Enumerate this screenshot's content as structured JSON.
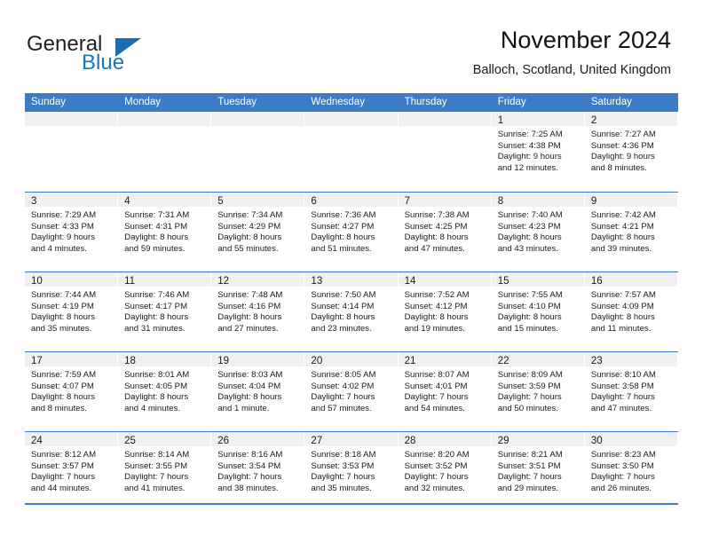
{
  "brand": {
    "name_part1": "General",
    "name_part2": "Blue",
    "triangle_color": "#1b6cb0",
    "blue_text_color": "#1b76bc"
  },
  "header": {
    "title": "November 2024",
    "subtitle": "Balloch, Scotland, United Kingdom"
  },
  "theme": {
    "header_row_color": "#3b7cc4",
    "day_band_color": "#f0f0f0",
    "grid_line_color": "#3b7cc4"
  },
  "weekdays": [
    "Sunday",
    "Monday",
    "Tuesday",
    "Wednesday",
    "Thursday",
    "Friday",
    "Saturday"
  ],
  "weeks": [
    [
      {
        "day": "",
        "empty": true,
        "sunrise": "",
        "sunset": "",
        "daylight_line1": "",
        "daylight_line2": ""
      },
      {
        "day": "",
        "empty": true,
        "sunrise": "",
        "sunset": "",
        "daylight_line1": "",
        "daylight_line2": ""
      },
      {
        "day": "",
        "empty": true,
        "sunrise": "",
        "sunset": "",
        "daylight_line1": "",
        "daylight_line2": ""
      },
      {
        "day": "",
        "empty": true,
        "sunrise": "",
        "sunset": "",
        "daylight_line1": "",
        "daylight_line2": ""
      },
      {
        "day": "",
        "empty": true,
        "sunrise": "",
        "sunset": "",
        "daylight_line1": "",
        "daylight_line2": ""
      },
      {
        "day": "1",
        "empty": false,
        "sunrise": "Sunrise: 7:25 AM",
        "sunset": "Sunset: 4:38 PM",
        "daylight_line1": "Daylight: 9 hours",
        "daylight_line2": "and 12 minutes."
      },
      {
        "day": "2",
        "empty": false,
        "sunrise": "Sunrise: 7:27 AM",
        "sunset": "Sunset: 4:36 PM",
        "daylight_line1": "Daylight: 9 hours",
        "daylight_line2": "and 8 minutes."
      }
    ],
    [
      {
        "day": "3",
        "empty": false,
        "sunrise": "Sunrise: 7:29 AM",
        "sunset": "Sunset: 4:33 PM",
        "daylight_line1": "Daylight: 9 hours",
        "daylight_line2": "and 4 minutes."
      },
      {
        "day": "4",
        "empty": false,
        "sunrise": "Sunrise: 7:31 AM",
        "sunset": "Sunset: 4:31 PM",
        "daylight_line1": "Daylight: 8 hours",
        "daylight_line2": "and 59 minutes."
      },
      {
        "day": "5",
        "empty": false,
        "sunrise": "Sunrise: 7:34 AM",
        "sunset": "Sunset: 4:29 PM",
        "daylight_line1": "Daylight: 8 hours",
        "daylight_line2": "and 55 minutes."
      },
      {
        "day": "6",
        "empty": false,
        "sunrise": "Sunrise: 7:36 AM",
        "sunset": "Sunset: 4:27 PM",
        "daylight_line1": "Daylight: 8 hours",
        "daylight_line2": "and 51 minutes."
      },
      {
        "day": "7",
        "empty": false,
        "sunrise": "Sunrise: 7:38 AM",
        "sunset": "Sunset: 4:25 PM",
        "daylight_line1": "Daylight: 8 hours",
        "daylight_line2": "and 47 minutes."
      },
      {
        "day": "8",
        "empty": false,
        "sunrise": "Sunrise: 7:40 AM",
        "sunset": "Sunset: 4:23 PM",
        "daylight_line1": "Daylight: 8 hours",
        "daylight_line2": "and 43 minutes."
      },
      {
        "day": "9",
        "empty": false,
        "sunrise": "Sunrise: 7:42 AM",
        "sunset": "Sunset: 4:21 PM",
        "daylight_line1": "Daylight: 8 hours",
        "daylight_line2": "and 39 minutes."
      }
    ],
    [
      {
        "day": "10",
        "empty": false,
        "sunrise": "Sunrise: 7:44 AM",
        "sunset": "Sunset: 4:19 PM",
        "daylight_line1": "Daylight: 8 hours",
        "daylight_line2": "and 35 minutes."
      },
      {
        "day": "11",
        "empty": false,
        "sunrise": "Sunrise: 7:46 AM",
        "sunset": "Sunset: 4:17 PM",
        "daylight_line1": "Daylight: 8 hours",
        "daylight_line2": "and 31 minutes."
      },
      {
        "day": "12",
        "empty": false,
        "sunrise": "Sunrise: 7:48 AM",
        "sunset": "Sunset: 4:16 PM",
        "daylight_line1": "Daylight: 8 hours",
        "daylight_line2": "and 27 minutes."
      },
      {
        "day": "13",
        "empty": false,
        "sunrise": "Sunrise: 7:50 AM",
        "sunset": "Sunset: 4:14 PM",
        "daylight_line1": "Daylight: 8 hours",
        "daylight_line2": "and 23 minutes."
      },
      {
        "day": "14",
        "empty": false,
        "sunrise": "Sunrise: 7:52 AM",
        "sunset": "Sunset: 4:12 PM",
        "daylight_line1": "Daylight: 8 hours",
        "daylight_line2": "and 19 minutes."
      },
      {
        "day": "15",
        "empty": false,
        "sunrise": "Sunrise: 7:55 AM",
        "sunset": "Sunset: 4:10 PM",
        "daylight_line1": "Daylight: 8 hours",
        "daylight_line2": "and 15 minutes."
      },
      {
        "day": "16",
        "empty": false,
        "sunrise": "Sunrise: 7:57 AM",
        "sunset": "Sunset: 4:09 PM",
        "daylight_line1": "Daylight: 8 hours",
        "daylight_line2": "and 11 minutes."
      }
    ],
    [
      {
        "day": "17",
        "empty": false,
        "sunrise": "Sunrise: 7:59 AM",
        "sunset": "Sunset: 4:07 PM",
        "daylight_line1": "Daylight: 8 hours",
        "daylight_line2": "and 8 minutes."
      },
      {
        "day": "18",
        "empty": false,
        "sunrise": "Sunrise: 8:01 AM",
        "sunset": "Sunset: 4:05 PM",
        "daylight_line1": "Daylight: 8 hours",
        "daylight_line2": "and 4 minutes."
      },
      {
        "day": "19",
        "empty": false,
        "sunrise": "Sunrise: 8:03 AM",
        "sunset": "Sunset: 4:04 PM",
        "daylight_line1": "Daylight: 8 hours",
        "daylight_line2": "and 1 minute."
      },
      {
        "day": "20",
        "empty": false,
        "sunrise": "Sunrise: 8:05 AM",
        "sunset": "Sunset: 4:02 PM",
        "daylight_line1": "Daylight: 7 hours",
        "daylight_line2": "and 57 minutes."
      },
      {
        "day": "21",
        "empty": false,
        "sunrise": "Sunrise: 8:07 AM",
        "sunset": "Sunset: 4:01 PM",
        "daylight_line1": "Daylight: 7 hours",
        "daylight_line2": "and 54 minutes."
      },
      {
        "day": "22",
        "empty": false,
        "sunrise": "Sunrise: 8:09 AM",
        "sunset": "Sunset: 3:59 PM",
        "daylight_line1": "Daylight: 7 hours",
        "daylight_line2": "and 50 minutes."
      },
      {
        "day": "23",
        "empty": false,
        "sunrise": "Sunrise: 8:10 AM",
        "sunset": "Sunset: 3:58 PM",
        "daylight_line1": "Daylight: 7 hours",
        "daylight_line2": "and 47 minutes."
      }
    ],
    [
      {
        "day": "24",
        "empty": false,
        "sunrise": "Sunrise: 8:12 AM",
        "sunset": "Sunset: 3:57 PM",
        "daylight_line1": "Daylight: 7 hours",
        "daylight_line2": "and 44 minutes."
      },
      {
        "day": "25",
        "empty": false,
        "sunrise": "Sunrise: 8:14 AM",
        "sunset": "Sunset: 3:55 PM",
        "daylight_line1": "Daylight: 7 hours",
        "daylight_line2": "and 41 minutes."
      },
      {
        "day": "26",
        "empty": false,
        "sunrise": "Sunrise: 8:16 AM",
        "sunset": "Sunset: 3:54 PM",
        "daylight_line1": "Daylight: 7 hours",
        "daylight_line2": "and 38 minutes."
      },
      {
        "day": "27",
        "empty": false,
        "sunrise": "Sunrise: 8:18 AM",
        "sunset": "Sunset: 3:53 PM",
        "daylight_line1": "Daylight: 7 hours",
        "daylight_line2": "and 35 minutes."
      },
      {
        "day": "28",
        "empty": false,
        "sunrise": "Sunrise: 8:20 AM",
        "sunset": "Sunset: 3:52 PM",
        "daylight_line1": "Daylight: 7 hours",
        "daylight_line2": "and 32 minutes."
      },
      {
        "day": "29",
        "empty": false,
        "sunrise": "Sunrise: 8:21 AM",
        "sunset": "Sunset: 3:51 PM",
        "daylight_line1": "Daylight: 7 hours",
        "daylight_line2": "and 29 minutes."
      },
      {
        "day": "30",
        "empty": false,
        "sunrise": "Sunrise: 8:23 AM",
        "sunset": "Sunset: 3:50 PM",
        "daylight_line1": "Daylight: 7 hours",
        "daylight_line2": "and 26 minutes."
      }
    ]
  ]
}
